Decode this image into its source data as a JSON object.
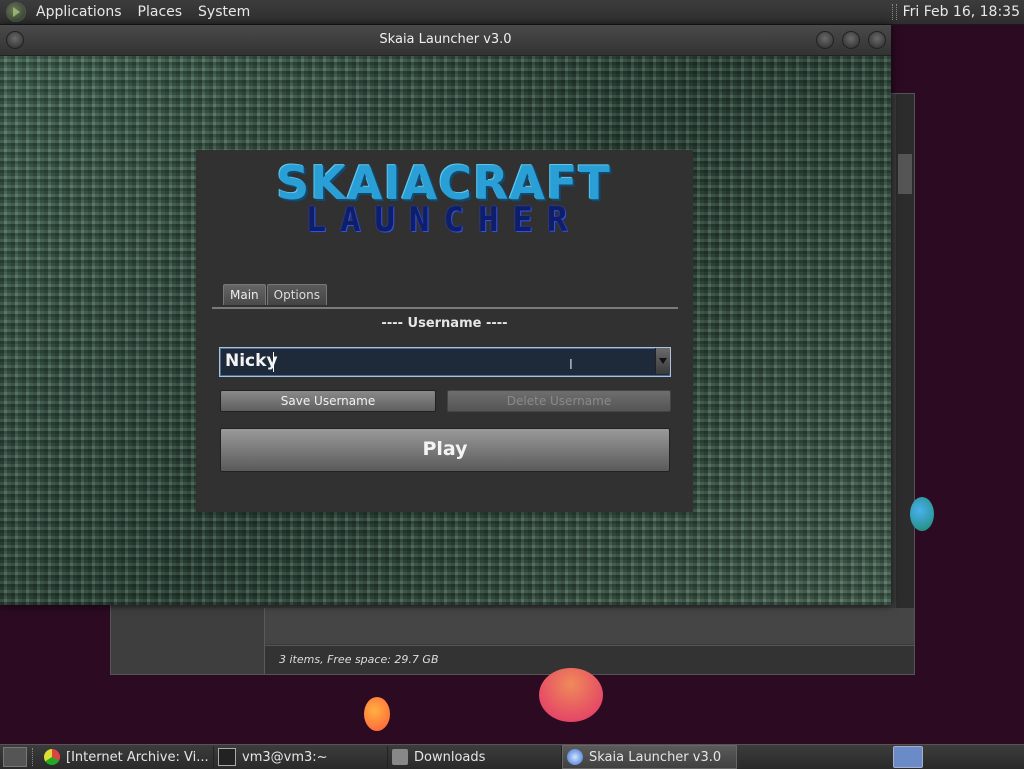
{
  "top_panel": {
    "menu": [
      "Applications",
      "Places",
      "System"
    ],
    "clock": "Fri Feb 16, 18:35"
  },
  "background_window": {
    "status": "3 items, Free space: 29.7 GB"
  },
  "launcher": {
    "title": "Skaia Launcher v3.0",
    "logo_main": "SKAIACRAFT",
    "logo_sub": "LAUNCHER",
    "tabs": [
      {
        "label": "Main",
        "active": true
      },
      {
        "label": "Options",
        "active": false
      }
    ],
    "section_label": "---- Username ----",
    "username_value": "Nicky",
    "save_button": "Save Username",
    "delete_button": "Delete Username",
    "play_button": "Play"
  },
  "taskbar": {
    "tasks": [
      {
        "label": "[Internet Archive: Vi...",
        "icon": "chrome-icon",
        "active": false
      },
      {
        "label": "vm3@vm3:~",
        "icon": "terminal-icon",
        "active": false
      },
      {
        "label": "Downloads",
        "icon": "folder-icon",
        "active": false
      },
      {
        "label": "Skaia Launcher v3.0",
        "icon": "globe-icon",
        "active": true
      }
    ]
  },
  "colors": {
    "desktop_bg": "#2b0a22",
    "logo_blue": "#2a9fd6",
    "logo_dark_blue": "#0f1e6a"
  }
}
